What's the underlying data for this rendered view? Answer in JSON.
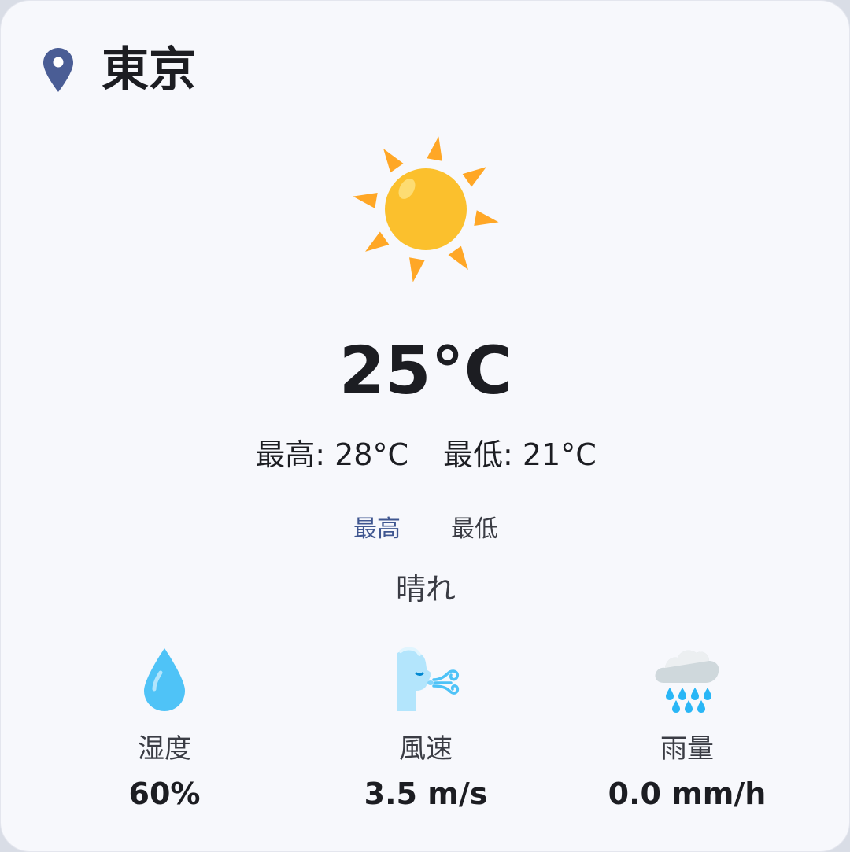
{
  "location": {
    "city": "東京",
    "icon": "location-pin-icon"
  },
  "current": {
    "icon": "sun-icon",
    "temperature": "25°C",
    "high_text": "最高: 28°C",
    "low_text": "最低: 21°C",
    "condition": "晴れ"
  },
  "toggle": {
    "high_label": "最高",
    "low_label": "最低",
    "active": "high"
  },
  "stats": [
    {
      "icon": "water-drop-icon",
      "label": "湿度",
      "value": "60%"
    },
    {
      "icon": "wind-face-icon",
      "label": "風速",
      "value": "3.5 m/s"
    },
    {
      "icon": "rain-cloud-icon",
      "label": "雨量",
      "value": "0.0 mm/h"
    }
  ],
  "colors": {
    "accent": "#3f5690",
    "pin": "#4a5d95",
    "sun_core": "#fbc02d",
    "sun_rays": "#ffa726",
    "drop": "#4fc3f7",
    "background": "#f7f8fc"
  }
}
